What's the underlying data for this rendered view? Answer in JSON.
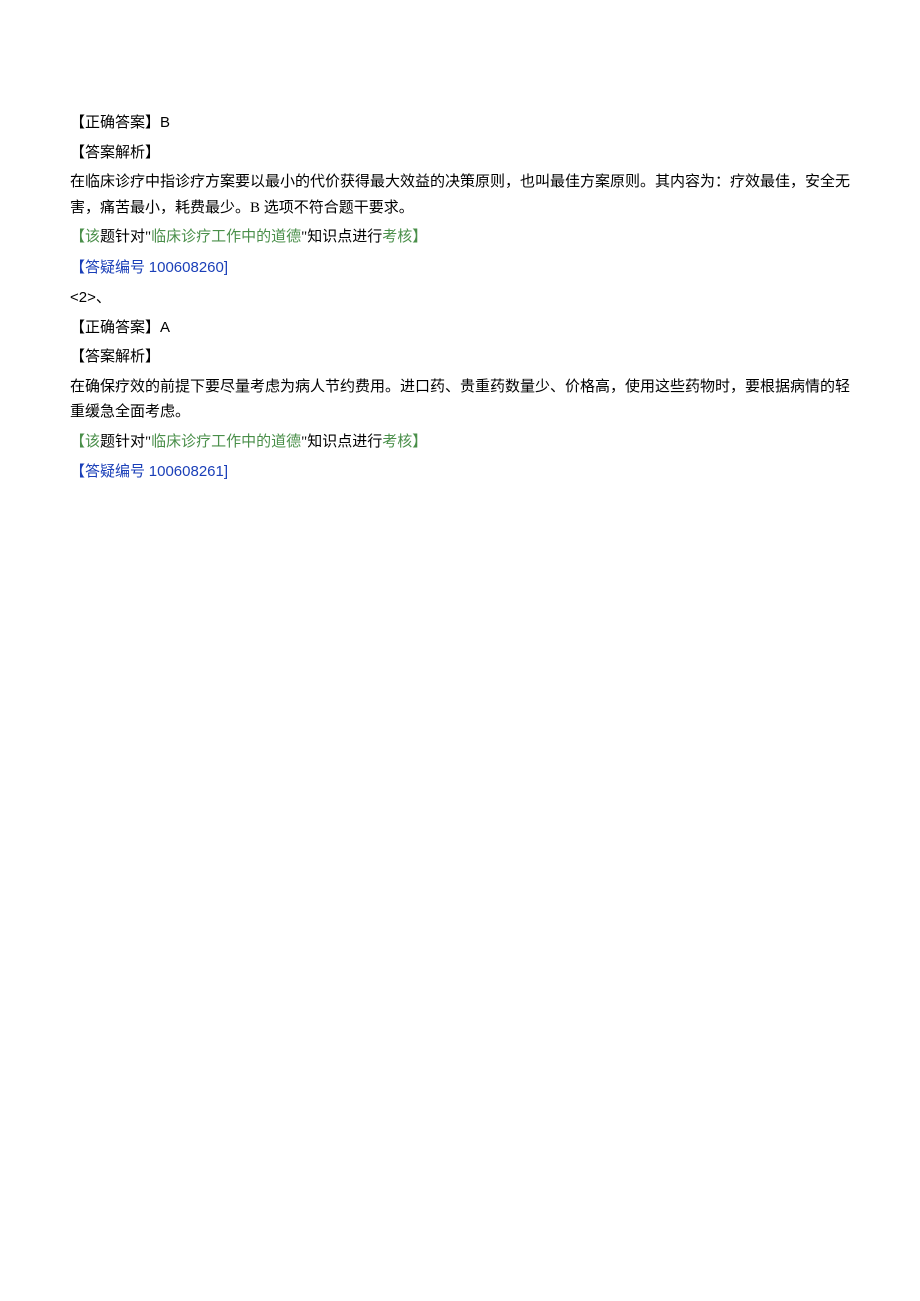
{
  "q1": {
    "answer_label": "【正确答案】",
    "answer_value": "B",
    "analysis_label": "【答案解析】",
    "analysis_body": "在临床诊疗中指诊疗方案要以最小的代价获得最大效益的决策原则，也叫最佳方案原则。其内容为：疗效最佳，安全无害，痛苦最小，耗费最少。B 选项不符合题干要求。",
    "tag_open": "【该",
    "tag_mid1": "题针对\"",
    "tag_topic": "临床诊疗工作中的道德",
    "tag_mid2": "\"知识点进行",
    "tag_end": "考核】",
    "ref_open": "【",
    "ref_label": "答疑编号 ",
    "ref_number": "100608260",
    "ref_close": "]"
  },
  "separator": "<2>、",
  "q2": {
    "answer_label": "【正确答案】",
    "answer_value": "A",
    "analysis_label": "【答案解析】",
    "analysis_body": "在确保疗效的前提下要尽量考虑为病人节约费用。进口药、贵重药数量少、价格高，使用这些药物时，要根据病情的轻重缓急全面考虑。",
    "tag_open": "【该",
    "tag_mid1": "题针对\"",
    "tag_topic": "临床诊疗工作中的道德",
    "tag_mid2": "\"知识点进行",
    "tag_end": "考核】",
    "ref_open": "【",
    "ref_label": "答疑编号 ",
    "ref_number": "100608261",
    "ref_close": "]"
  }
}
